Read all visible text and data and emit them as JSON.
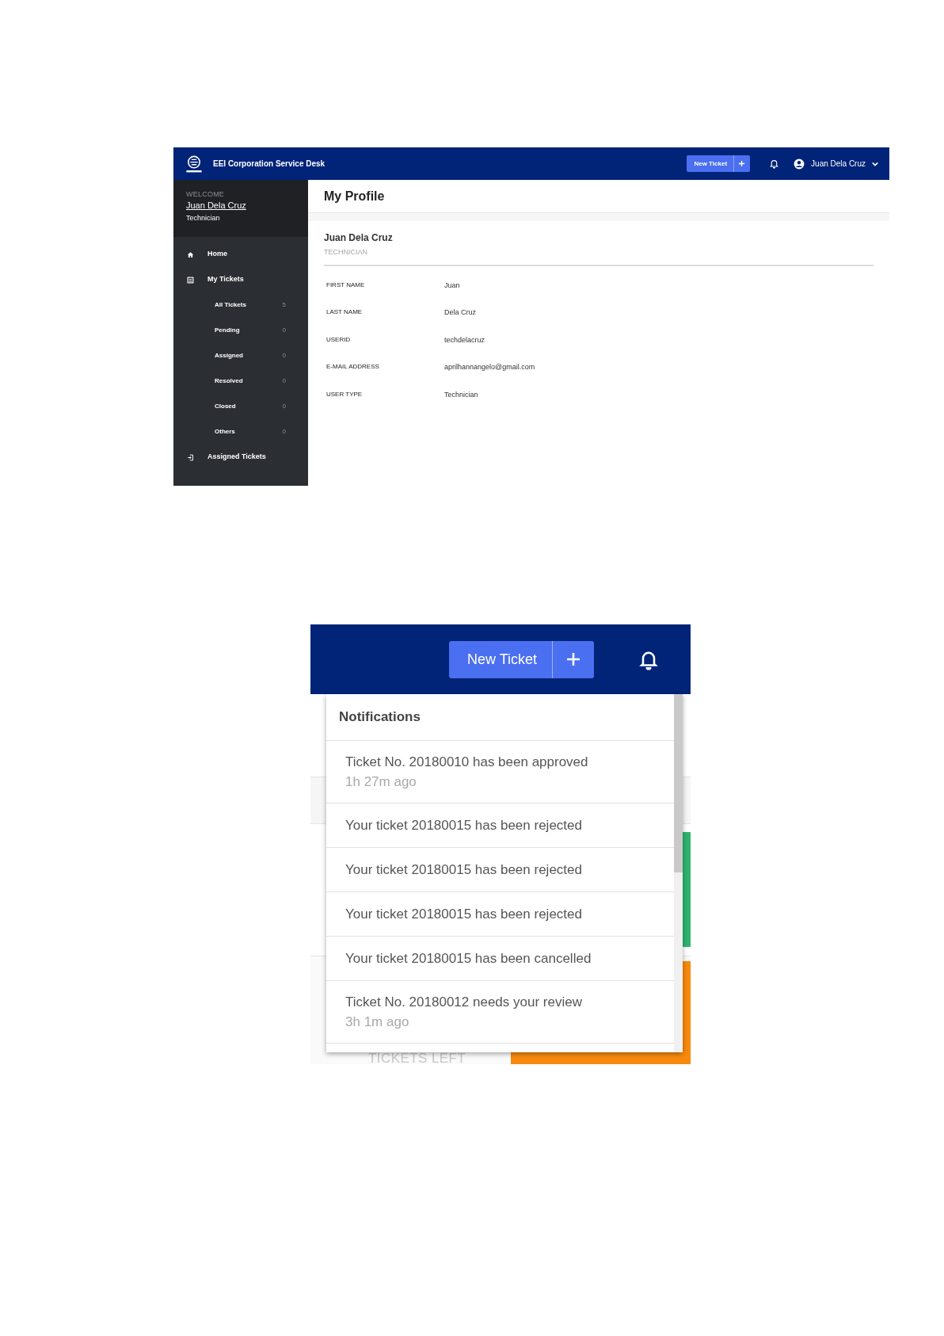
{
  "profile_screen": {
    "app_title": "EEI Corporation Service Desk",
    "new_ticket_button": "New Ticket",
    "user_menu": "Juan Dela Cruz",
    "sidebar": {
      "welcome": "WELCOME",
      "user_name": "Juan Dela Cruz",
      "role": "Technician",
      "items": [
        {
          "kind": "nav",
          "label": "Home"
        },
        {
          "kind": "nav",
          "label": "My Tickets"
        },
        {
          "kind": "sub",
          "label": "All Tickets",
          "count": "5"
        },
        {
          "kind": "sub",
          "label": "Pending",
          "count": "0"
        },
        {
          "kind": "sub",
          "label": "Assigned",
          "count": "0"
        },
        {
          "kind": "sub",
          "label": "Resolved",
          "count": "0"
        },
        {
          "kind": "sub",
          "label": "Closed",
          "count": "0"
        },
        {
          "kind": "sub",
          "label": "Others",
          "count": "0"
        },
        {
          "kind": "nav",
          "label": "Assigned Tickets"
        }
      ]
    },
    "page_title": "My Profile",
    "name": "Juan Dela Cruz",
    "user_type_caption": "TECHNICIAN",
    "fields": [
      {
        "label": "FIRST NAME",
        "value": "Juan"
      },
      {
        "label": "LAST NAME",
        "value": "Dela Cruz"
      },
      {
        "label": "USERID",
        "value": "techdelacruz"
      },
      {
        "label": "E-MAIL ADDRESS",
        "value": "aprilhannangelo@gmail.com"
      },
      {
        "label": "USER TYPE",
        "value": "Technician"
      }
    ]
  },
  "notifications_screen": {
    "new_ticket_button": "New Ticket",
    "background_label": "TICKETS LEFT",
    "dropdown": {
      "title": "Notifications",
      "items": [
        {
          "text": "Ticket No. 20180010 has been approved",
          "time": "1h 27m ago"
        },
        {
          "text": "Your ticket 20180015 has been rejected"
        },
        {
          "text": "Your ticket 20180015 has been rejected"
        },
        {
          "text": "Your ticket 20180015 has been rejected"
        },
        {
          "text": "Your ticket 20180015 has been cancelled"
        },
        {
          "text": "Ticket No. 20180012 needs your review",
          "time": "3h 1m ago"
        }
      ]
    }
  }
}
